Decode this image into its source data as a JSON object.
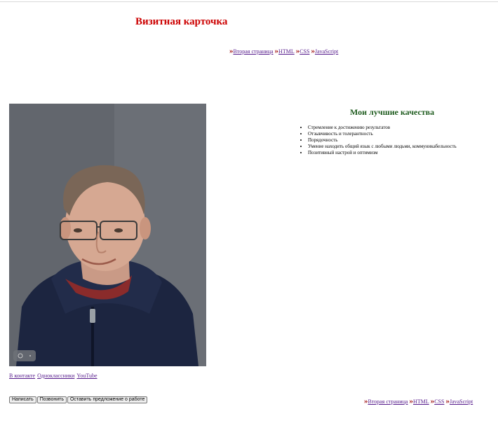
{
  "header": {
    "title": "Визитная карточка"
  },
  "nav": {
    "arrow": "»",
    "links": [
      "Вторая страница",
      "HTML",
      "CSS",
      "JavaScript"
    ]
  },
  "photo": {
    "alt_icon": "camera-icon"
  },
  "social": {
    "links": [
      "В контакте",
      "Одноклассники",
      "YouTube"
    ]
  },
  "actions": {
    "buttons": [
      "Написать",
      "Позвонить",
      "Оставить предложение о работе"
    ]
  },
  "qualities": {
    "title": "Мои лучшие качества",
    "items": [
      "Стремление к достижению результатов",
      "Отзывчивость и толерантность",
      "Порядочность",
      "Умение находить общий язык с любыми людьми, коммуникабельность",
      "Позитивный настрой и оптимизм"
    ]
  },
  "colors": {
    "title": "#cc0000",
    "link": "#551a8b",
    "arrow": "#990000",
    "qualities_title": "#1f5c1f"
  }
}
